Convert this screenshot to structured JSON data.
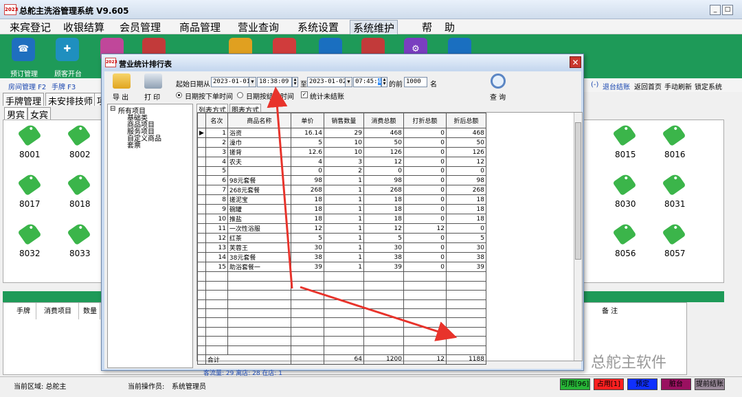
{
  "app": {
    "title": "总舵主洗浴管理系统 V9.605",
    "logo": "2023",
    "window_buttons": [
      "_",
      "□",
      "✕"
    ]
  },
  "menu": [
    "来宾登记",
    "收银结算",
    "会员管理",
    "商品管理",
    "营业查询",
    "系统设置",
    "系统维护",
    "帮",
    "助"
  ],
  "toolbar": {
    "items": [
      "预订管理",
      "顾客开台"
    ]
  },
  "subbar": {
    "left": [
      "房间管理 F2",
      "手牌 F3"
    ],
    "right": [
      "(-)",
      "退台结账",
      "返回首页",
      "手动刷新",
      "锁定系统"
    ]
  },
  "tabs": {
    "top": [
      "手牌管理",
      "未安排技师",
      "项"
    ],
    "gender": [
      "男宾",
      "女宾"
    ]
  },
  "rooms": [
    "8001",
    "8002",
    "8015",
    "8016",
    "8017",
    "8018",
    "8030",
    "8031",
    "8032",
    "8033",
    "8056",
    "8057"
  ],
  "bottom": {
    "headers": [
      "手牌",
      "消费项目",
      "数量",
      "备 注"
    ]
  },
  "status": {
    "area_label": "当前区域: 总舵主",
    "operator_label": "当前操作员:",
    "operator": "系统管理员",
    "buttons": [
      {
        "label": "可用[96]",
        "color": "#27b437"
      },
      {
        "label": "占用[1]",
        "color": "#ff2020"
      },
      {
        "label": "预定",
        "color": "#1030ff"
      },
      {
        "label": "脏台",
        "color": "#9a1060"
      },
      {
        "label": "提前结账",
        "color": "#9a8a9a"
      }
    ]
  },
  "dialog": {
    "title": "营业统计排行表",
    "logo": "2023",
    "close": "✕",
    "export_label": "导 出",
    "print_label": "打 印",
    "query_label": "查 询",
    "start_label": "起始日期从",
    "start_date": "2023-01-01",
    "start_time": "18:38:09",
    "to_label": "至",
    "end_date": "2023-01-02",
    "end_time_prefix": "07:45:",
    "end_time_sec": "42",
    "before_label": "的前",
    "top_n": "1000",
    "name_unit": "名",
    "radio1": "日期按下单时间",
    "radio2": "日期按结账时间",
    "check_label": "统计未结账",
    "check_mark": "✓",
    "tree": [
      "所有项目",
      "基础类",
      "商品项目",
      "服务项目",
      "自定义商品",
      "套票"
    ],
    "tree_toggle": "⊟",
    "view_tabs": [
      "列表方式",
      "图表方式"
    ],
    "columns": [
      "名次",
      "商品名称",
      "单价",
      "销售数量",
      "消费总额",
      "打折总额",
      "折后总额"
    ],
    "rows": [
      [
        "1",
        "浴资",
        "16.14",
        "29",
        "468",
        "0",
        "468"
      ],
      [
        "2",
        "澡巾",
        "5",
        "10",
        "50",
        "0",
        "50"
      ],
      [
        "3",
        "搓背",
        "12.6",
        "10",
        "126",
        "0",
        "126"
      ],
      [
        "4",
        "农夫",
        "4",
        "3",
        "12",
        "0",
        "12"
      ],
      [
        "5",
        "",
        "0",
        "2",
        "0",
        "0",
        "0"
      ],
      [
        "6",
        "98元套餐",
        "98",
        "1",
        "98",
        "0",
        "98"
      ],
      [
        "7",
        "268元套餐",
        "268",
        "1",
        "268",
        "0",
        "268"
      ],
      [
        "8",
        "搓泥宝",
        "18",
        "1",
        "18",
        "0",
        "18"
      ],
      [
        "9",
        "碗罐",
        "18",
        "1",
        "18",
        "0",
        "18"
      ],
      [
        "10",
        "推盐",
        "18",
        "1",
        "18",
        "0",
        "18"
      ],
      [
        "11",
        "一次性浴服",
        "12",
        "1",
        "12",
        "12",
        "0"
      ],
      [
        "12",
        "红茶",
        "5",
        "1",
        "5",
        "0",
        "5"
      ],
      [
        "13",
        "芙蓉王",
        "30",
        "1",
        "30",
        "0",
        "30"
      ],
      [
        "14",
        "38元套餐",
        "38",
        "1",
        "38",
        "0",
        "38"
      ],
      [
        "15",
        "助浴套餐一",
        "39",
        "1",
        "39",
        "0",
        "39"
      ]
    ],
    "total": {
      "label": "合计",
      "qty": "64",
      "amount": "1200",
      "discount": "12",
      "net": "1188"
    },
    "footer": "客流量: 29 离店: 28 在店: 1"
  },
  "watermark": "总舵主软件",
  "colors": {
    "toolbar_green": "#1e9a58",
    "tag_green": "#3bb54a",
    "arrow_red": "#e8332b",
    "link_blue": "#1a47b0"
  }
}
